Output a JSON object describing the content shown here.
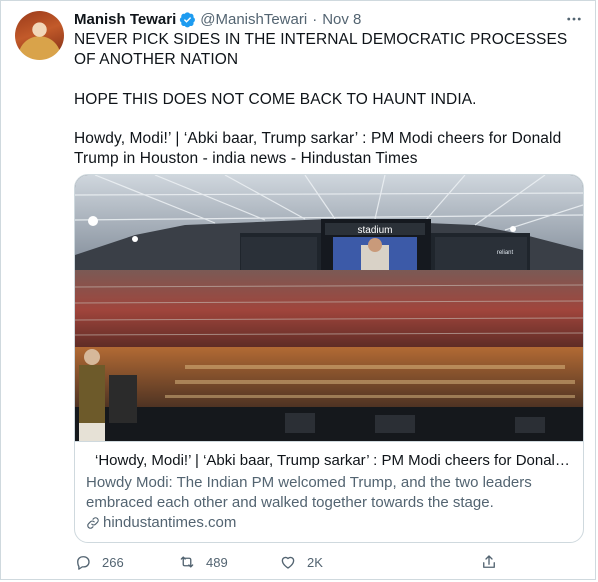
{
  "author": {
    "name": "Manish Tewari",
    "handle": "@ManishTewari",
    "separator": "·",
    "date": "Nov 8"
  },
  "tweet": {
    "line1": "NEVER PICK SIDES IN THE INTERNAL DEMOCRATIC PROCESSES OF ANOTHER NATION",
    "line2": "HOPE THIS DOES NOT COME BACK TO HAUNT INDIA.",
    "line3": "Howdy, Modi!’   |   ‘Abki baar, Trump sarkar’   : PM Modi cheers for Donald Trump in Houston - india news - Hindustan Times"
  },
  "card": {
    "image_screen_text": "stadium",
    "image_brand_text": "reliant",
    "title": "‘Howdy, Modi!’   |   ‘Abki baar, Trump sarkar’   : PM Modi cheers for Donald Trump in Houston - india news - Hindustan Times",
    "description": "Howdy Modi: The Indian PM welcomed Trump, and the two leaders embraced each other and walked together towards the stage.",
    "domain": "hindustantimes.com"
  },
  "actions": {
    "replies": "266",
    "retweets": "489",
    "likes": "2K"
  },
  "colors": {
    "verified": "#1d9bf0",
    "secondary_text": "#536471",
    "border": "#cfd9de"
  },
  "icons": [
    "verified-badge-icon",
    "more-icon",
    "link-icon",
    "reply-icon",
    "retweet-icon",
    "like-icon",
    "share-icon"
  ]
}
